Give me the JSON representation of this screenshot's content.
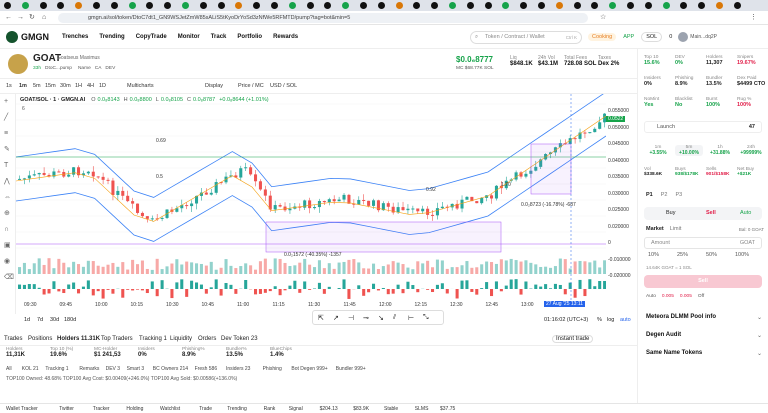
{
  "browser": {
    "url": "gmgn.ai/sol/token/DtoC7dt1_GN9WSJetZmW85sALiS5tKyoDrYoSd3zNfWe5RFMTD/pump?tag=bot&min=5",
    "tabs_count": 42
  },
  "site": {
    "logo": "GMGN",
    "nav": [
      "Trenches",
      "Trending",
      "CopyTrade",
      "Monitor",
      "Track",
      "Portfolio",
      "Rewards"
    ],
    "search_placeholder": "Token / Contract / Wallet",
    "search_hint": "Ctrl K",
    "cooking": "Cooking",
    "app": "APP",
    "chain": "SOL",
    "sol_balance": "0",
    "wallet_label": "Main...dq2P"
  },
  "token": {
    "symbol": "GOAT",
    "name": "Goatseus Maximus",
    "age": "33h",
    "id": "DtoC...pump",
    "tags": [
      "Name",
      "CA",
      "DEV"
    ],
    "price": "$0.0₆8777",
    "price_change": "0.0%",
    "mc": "MC $68.77K SOL",
    "liq_label": "Liq",
    "liq": "$848.1K",
    "vol_label": "24h Vol",
    "vol": "$43.1M",
    "supply_label": "Total Fees",
    "supply": "728.08 SOL",
    "taxes_label": "Taxes",
    "taxes": "Dex 2%"
  },
  "chart_toolbar": {
    "timeframes": [
      "1s",
      "1m",
      "5m",
      "15m",
      "30m",
      "1H",
      "4H",
      "1D"
    ],
    "active": "1m",
    "multicharts": "Multicharts",
    "display": "Display",
    "price_mode": "Price / MC",
    "currency": "USD / SOL"
  },
  "ohlc": {
    "pair": "GOAT/SOL · 1 · GMGN.AI",
    "o": "0.0₈8143",
    "h": "0.0₈8800",
    "l": "0.0₈8105",
    "c": "0.0₈8787",
    "chg": "+0.0₈8644 (+1.01%)",
    "volume_count": "6"
  },
  "chart_data": {
    "type": "candlestick",
    "x_labels": [
      "09:30",
      "09:45",
      "10:00",
      "10:15",
      "10:30",
      "10:45",
      "11:00",
      "11:15",
      "11:30",
      "11:45",
      "12:00",
      "12:15",
      "12:30",
      "12:45",
      "13:00",
      "13:15"
    ],
    "y_labels": [
      "0.055000",
      "0.050000",
      "0.045000",
      "0.040000",
      "0.035000",
      "0.030000",
      "0.025000",
      "0.020000",
      "0",
      "-0.010000",
      "-0.020000"
    ],
    "annotations": [
      "0.0₂1572 (-40.35%) -1357",
      "0.0₂8723 (-16.78%) -687",
      "1.70",
      "0.92",
      "0.69",
      "0.5"
    ],
    "current_price": "0.0522"
  },
  "range_bar": {
    "ranges": [
      "1d",
      "7d",
      "30d",
      "180d"
    ],
    "time": "01:16:02 (UTC+3)",
    "pct": "%",
    "log": "log",
    "auto": "auto",
    "date_marker": "27 Aug '25 13:11"
  },
  "bottom_tabs": [
    "Trades",
    "Positions",
    "Holders 11.31K",
    "Top Traders",
    "Tracking 1",
    "Liquidity",
    "Orders",
    "Dev Token 23"
  ],
  "instant_trade": "Instant trade",
  "holder_stats": [
    {
      "label": "Holders",
      "value": "11,31K"
    },
    {
      "label": "Top 10 (%)",
      "value": "19.6%"
    },
    {
      "label": "MC-Holder",
      "value": "$1 241,53"
    },
    {
      "label": "Insiders",
      "value": "0%"
    },
    {
      "label": "Phishing%",
      "value": "8.9%"
    },
    {
      "label": "Bundler%",
      "value": "13.5%"
    },
    {
      "label": "BlueChips",
      "value": "1.4%"
    }
  ],
  "filters": [
    "All",
    "KOL 21",
    "Tracking 1",
    "Remarks",
    "DEV 3",
    "Smart 3",
    "BC Owners 214",
    "Fresh 586",
    "Insiders 23",
    "Phishing",
    "Bot Degen 999+",
    "Bundler 999+"
  ],
  "top_row": "TOP100 Owned: 48.68%   TOP100 Avg Cost: $0.00409(+246.0%)   TOP100 Avg Sold: $0.00586(+136.0%)",
  "status_bar": [
    "Wallet Tracker",
    "Twitter",
    "Tracker",
    "Holding",
    "Watchlist",
    "Trade",
    "Trending",
    "Rank",
    "Signal",
    "$204.13",
    "$83.9K",
    "Stable",
    "SLMS",
    "$37.75"
  ],
  "right": {
    "stats": [
      {
        "l": "Top 10",
        "v": "15.6%",
        "c": "g"
      },
      {
        "l": "DEV",
        "v": "0%",
        "c": "g"
      },
      {
        "l": "Holders",
        "v": "11,307",
        "c": ""
      },
      {
        "l": "Snipers",
        "v": "19.67%",
        "c": "r"
      },
      {
        "l": "Insiders",
        "v": "0%",
        "c": ""
      },
      {
        "l": "Phishing",
        "v": "8.9%",
        "c": ""
      },
      {
        "l": "Bundler",
        "v": "13.5%",
        "c": ""
      },
      {
        "l": "Dex Paid",
        "v": "$4499 CTO",
        "c": ""
      },
      {
        "l": "NoMint",
        "v": "Yes",
        "c": "g"
      },
      {
        "l": "Blacklist",
        "v": "No",
        "c": "g"
      },
      {
        "l": "Burnt",
        "v": "100%",
        "c": "g"
      },
      {
        "l": "Rug %",
        "v": "100%",
        "c": "r"
      }
    ],
    "launch": "Launch",
    "launch_count": "47",
    "periods": [
      {
        "l": "1m",
        "v": "+3.55%"
      },
      {
        "l": "5m",
        "v": "+10.00%"
      },
      {
        "l": "1h",
        "v": "+31.88%"
      },
      {
        "l": "24h",
        "v": "+99999%"
      }
    ],
    "vol_row": [
      {
        "l": "Vol",
        "v": "$338.6K"
      },
      {
        "l": "Buys",
        "v": "938/$178K"
      },
      {
        "l": "Sells",
        "v": "901/$158K"
      },
      {
        "l": "Net Buy",
        "v": "+$21K"
      }
    ],
    "presets": [
      "P1",
      "P2",
      "P3"
    ],
    "buy": "Buy",
    "sell": "Sell",
    "auto": "Auto",
    "market": "Market",
    "limit": "Limit",
    "balance": "Bal: 0 GOAT",
    "amount": "Amount",
    "amount_unit": "GOAT",
    "pcts": [
      "10%",
      "25%",
      "50%",
      "100%"
    ],
    "rate": "14.64K GOAT = 1 SOL",
    "sell_btn": "Sell",
    "settings": [
      "Auto",
      "0.005",
      "0.005",
      "Off"
    ],
    "pool": "Meteora DLMM Pool info",
    "audit": "Degen Audit",
    "same_name": "Same Name Tokens"
  },
  "colors": {
    "green": "#16a34a",
    "red": "#e11d48",
    "up_candle": "#26a69a",
    "down_candle": "#ef5350",
    "accent": "#22c55e"
  }
}
